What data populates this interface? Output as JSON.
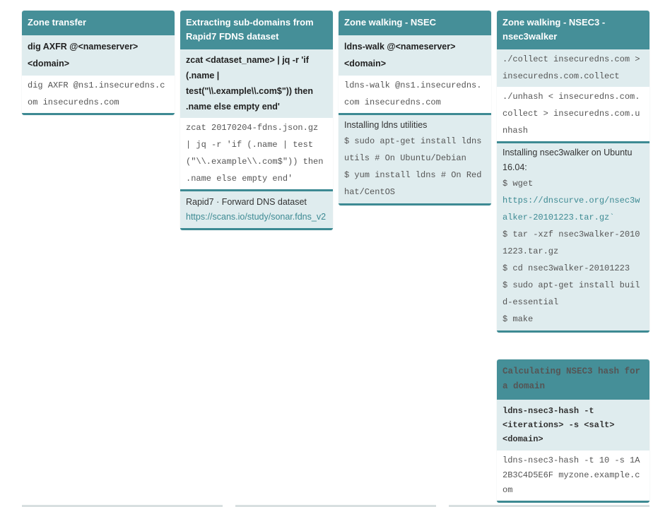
{
  "cards": {
    "zone_transfer": {
      "title": "Zone transfer",
      "command": "dig AXFR @<nameserver> <domain>",
      "example": "dig AXFR @ns1.insecuredns.com insecuredns.com"
    },
    "extract_subdomains": {
      "title": "Extracting sub-domains from Rapid7 FDNS dataset",
      "command": "zcat <dataset_name> | jq -r 'if (.name | test(\"\\\\.example\\\\.com$\")) then .name else empty end'",
      "example": "zcat 20170204-fdns.json.gz | jq -r 'if (.name | test(\"\\\\.example\\\\.com$\")) then .name else empty end'",
      "source_label": "Rapid7 · Forward DNS dataset",
      "source_link": "https://scans.io/study/sonar.fdns_v2"
    },
    "zone_walking_nsec": {
      "title": "Zone walking - NSEC",
      "command": "ldns-walk @<nameserver> <domain>",
      "example": "ldns-walk @ns1.insecuredns.com insecuredns.com",
      "install_label": "Installing ldns utilities",
      "install_debian": "$ sudo apt-get install ldnsutils # On Ubuntu/Debian",
      "install_redhat": "$ yum install ldns # On Redhat/CentOS"
    },
    "zone_walking_nsec3": {
      "title": "Zone walking - NSEC3 - nsec3walker",
      "collect": "./collect insecuredns.com > insecuredns.com.collect",
      "unhash": "./unhash < insecuredns.com.collect > insecuredns.com.unhash",
      "install_label": "Installing nsec3walker on Ubuntu 16.04:",
      "cmd_wget": "$ wget",
      "wget_url": "https://dnscurve.org/nsec3walker-20101223.tar.gz`",
      "cmd_tar": "$ tar -xzf nsec3walker-20101223.tar.gz",
      "cmd_cd": "$ cd nsec3walker-20101223",
      "cmd_apt": "$ sudo apt-get install build-essential",
      "cmd_make": "$ make"
    },
    "nsec3_hash": {
      "title": "Calculating NSEC3 hash for a domain",
      "command": "ldns-nsec3-hash -t <iterations> -s <salt> <domain>",
      "example": "ldns-nsec3-hash -t 10 -s 1A2B3C4D5E6F myzone.example.com"
    }
  }
}
